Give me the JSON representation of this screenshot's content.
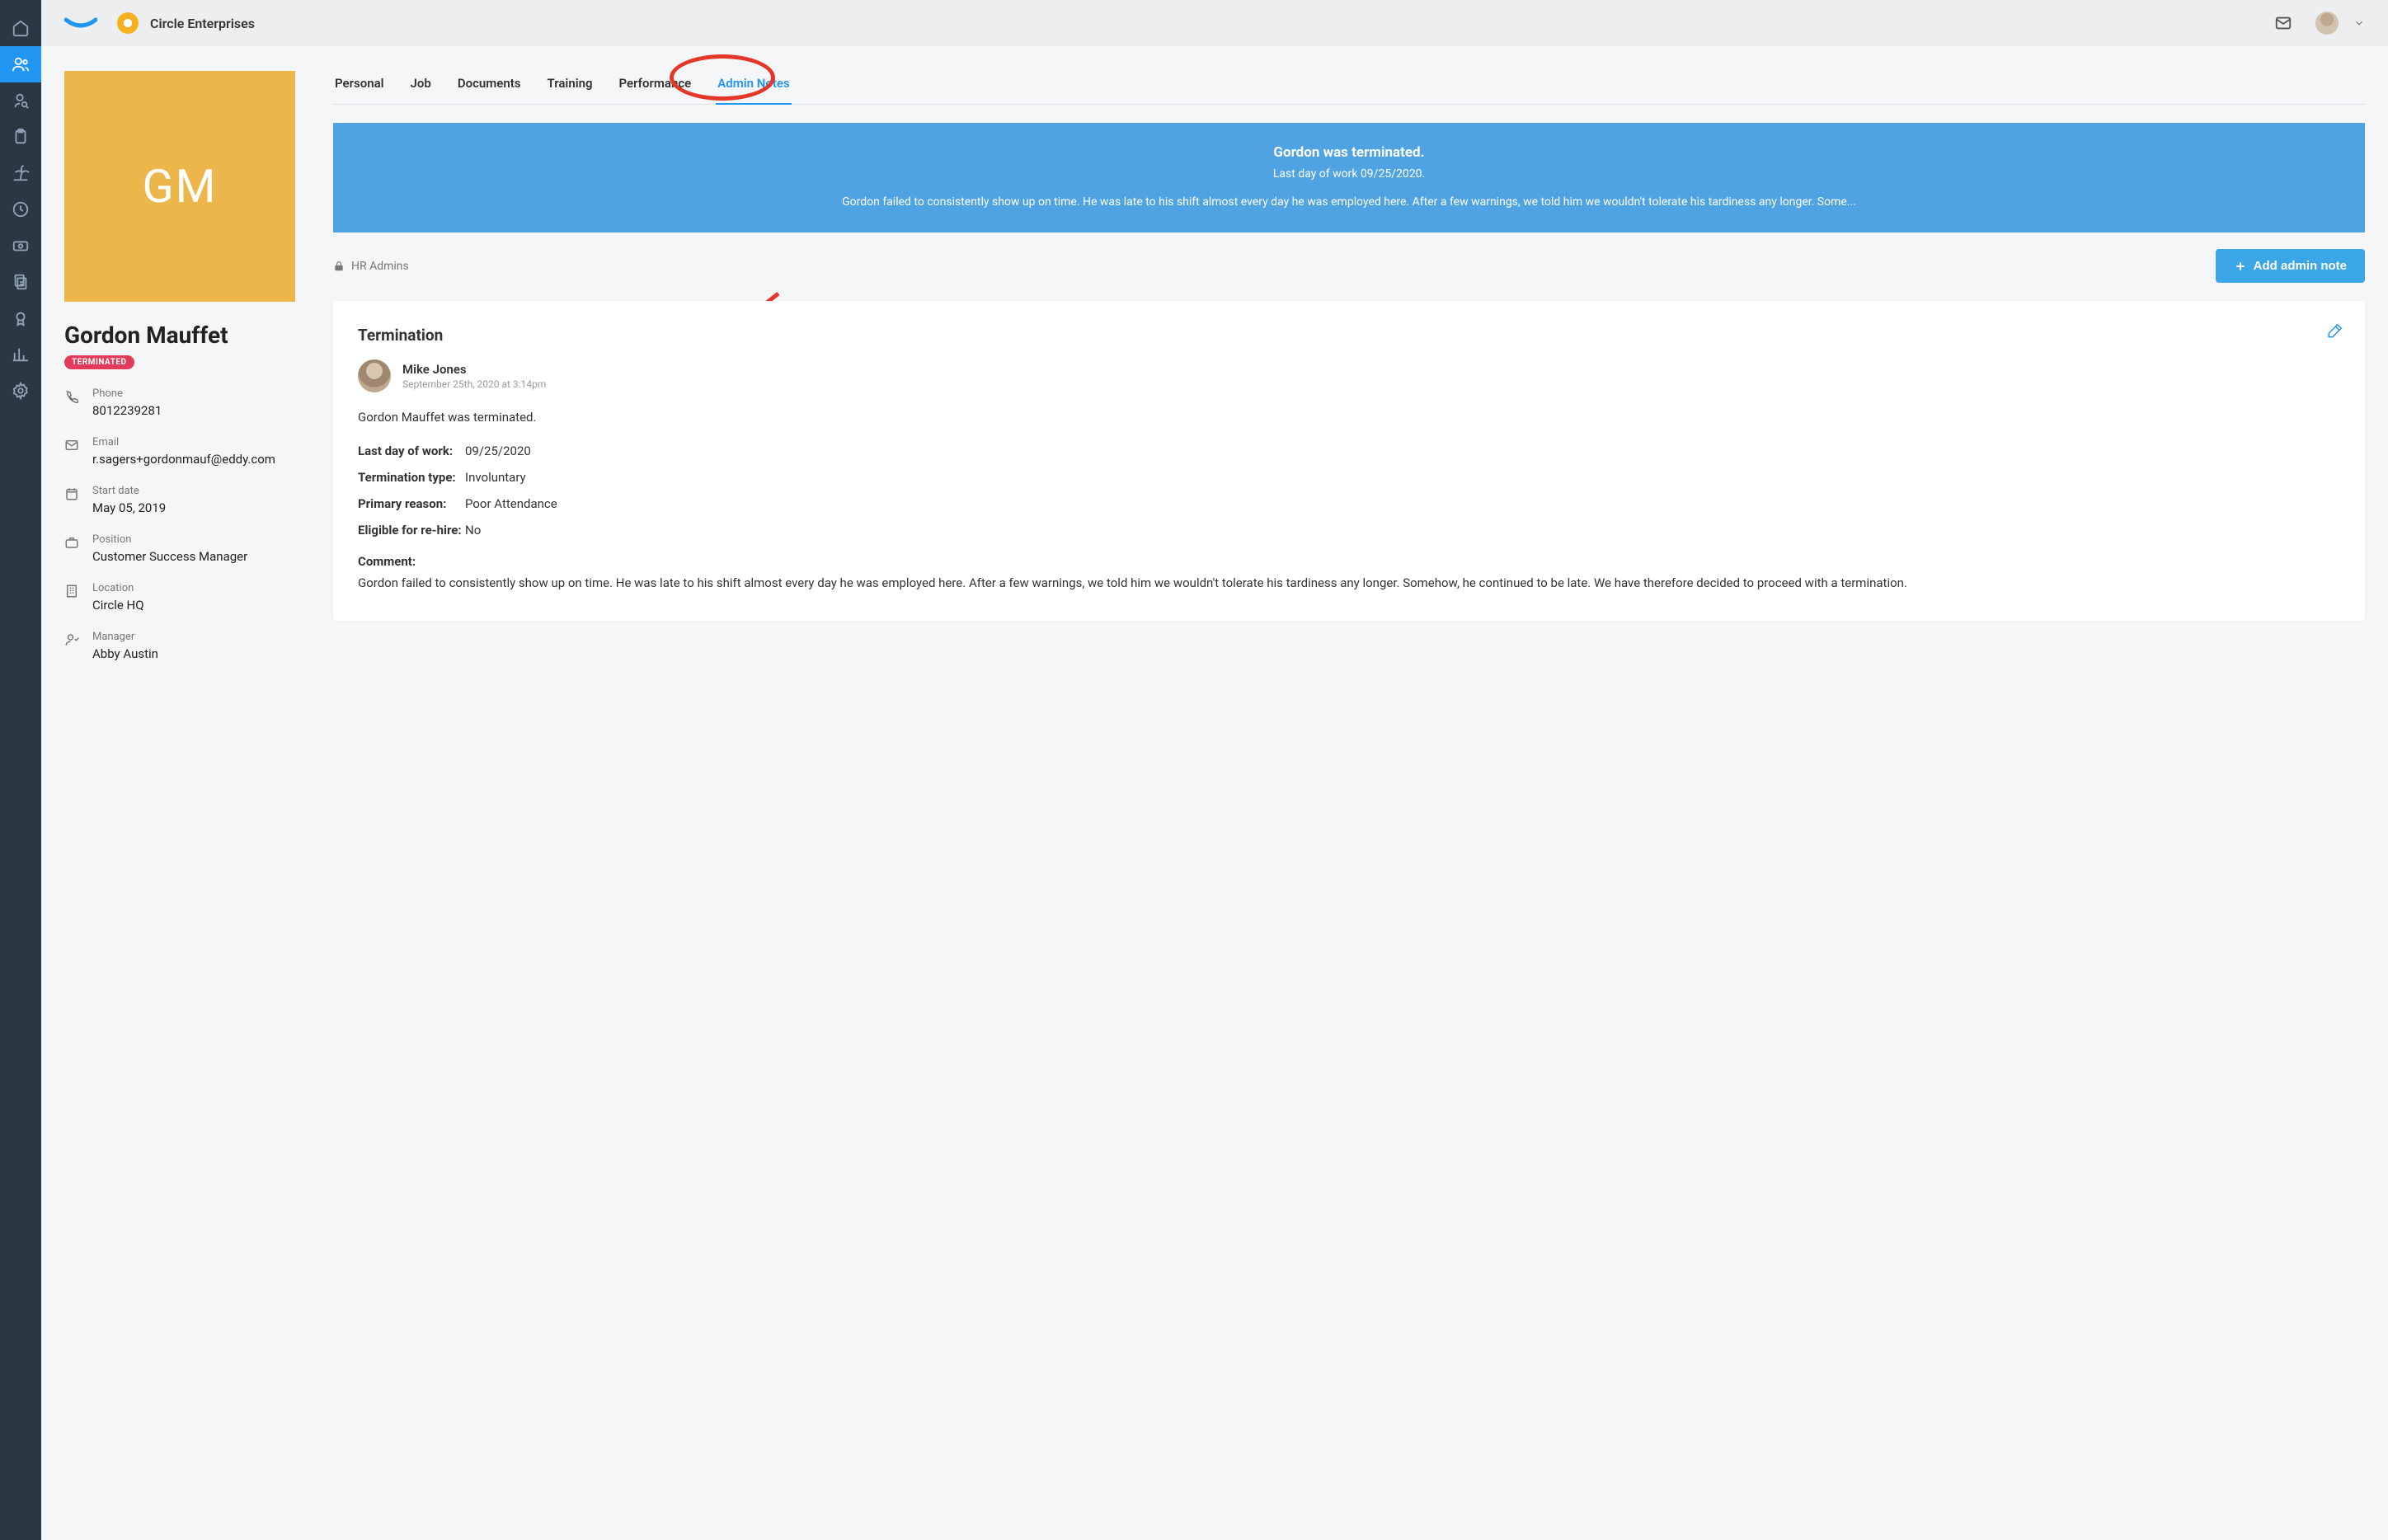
{
  "header": {
    "org_name": "Circle Enterprises"
  },
  "employee": {
    "initials": "GM",
    "name": "Gordon Mauffet",
    "status": "TERMINATED",
    "phone_label": "Phone",
    "phone": "8012239281",
    "email_label": "Email",
    "email": "r.sagers+gordonmauf@eddy.com",
    "start_label": "Start date",
    "start": "May 05, 2019",
    "position_label": "Position",
    "position": "Customer Success Manager",
    "location_label": "Location",
    "location": "Circle HQ",
    "manager_label": "Manager",
    "manager": "Abby Austin"
  },
  "tabs": {
    "personal": "Personal",
    "job": "Job",
    "documents": "Documents",
    "training": "Training",
    "performance": "Performance",
    "admin_notes": "Admin Notes"
  },
  "banner": {
    "title": "Gordon was terminated.",
    "sub": "Last day of work 09/25/2020.",
    "text": "Gordon failed to consistently show up on time. He was late to his shift almost every day he was employed here. After a few warnings, we told him we wouldn't tolerate his tardiness any longer. Some..."
  },
  "section": {
    "visibility": "HR Admins",
    "add_button": "Add admin note"
  },
  "note": {
    "title": "Termination",
    "author": "Mike Jones",
    "date": "September 25th, 2020 at 3:14pm",
    "body": "Gordon Mauffet was terminated.",
    "last_day_label": "Last day of work:",
    "last_day": "09/25/2020",
    "type_label": "Termination type:",
    "type": "Involuntary",
    "reason_label": "Primary reason:",
    "reason": "Poor Attendance",
    "rehire_label": "Eligible for re-hire:",
    "rehire": "No",
    "comment_label": "Comment:",
    "comment": "Gordon failed to consistently show up on time. He was late to his shift almost every day he was employed here. After a few warnings, we told him we wouldn't tolerate his tardiness any longer. Somehow, he continued to be late. We have therefore decided to proceed with a termination."
  }
}
